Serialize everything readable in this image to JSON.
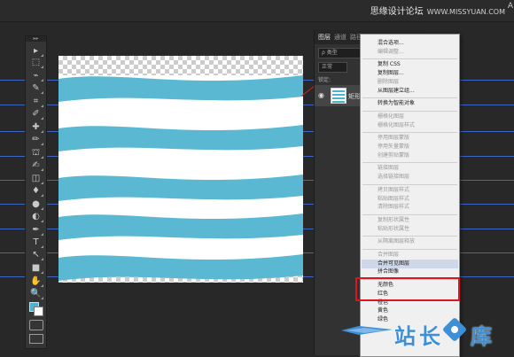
{
  "header": {
    "watermark": "思缘设计论坛",
    "watermark_url": "WWW.MISSYUAN.COM",
    "right_glyph": "A"
  },
  "tools": {
    "panel_grip": "▸▸",
    "icons": [
      "move-icon",
      "marquee-icon",
      "lasso-icon",
      "quick-select-icon",
      "crop-icon",
      "eyedropper-icon",
      "healing-brush-icon",
      "brush-icon",
      "clone-stamp-icon",
      "history-brush-icon",
      "eraser-icon",
      "paint-bucket-icon",
      "blur-icon",
      "dodge-icon",
      "pen-icon",
      "type-icon",
      "path-select-icon",
      "rectangle-icon",
      "hand-icon",
      "zoom-icon"
    ],
    "glyphs": [
      "▸",
      "⬚",
      "⌁",
      "✎",
      "⌗",
      "✐",
      "✚",
      "✏",
      "⛫",
      "✍",
      "◫",
      "♦",
      "●",
      "◐",
      "✒",
      "T",
      "↖",
      "■",
      "✋",
      "🔍"
    ]
  },
  "colors": {
    "foreground": "#4db3cf",
    "background": "#ffffff",
    "wave": "#5bb8d2"
  },
  "layers_panel": {
    "tabs": [
      "图层",
      "通道",
      "路径"
    ],
    "filter": "ρ 类型",
    "blend_mode": "正常",
    "lock_label": "锁定:",
    "layer_name": "矩形"
  },
  "context_menu": {
    "items": [
      {
        "label": "混合选项...",
        "enabled": true
      },
      {
        "label": "编辑调整...",
        "enabled": false
      },
      {
        "sep": true
      },
      {
        "label": "复制 CSS",
        "enabled": true
      },
      {
        "label": "复制图层...",
        "enabled": true
      },
      {
        "label": "删除图层",
        "enabled": false
      },
      {
        "label": "从图层建立组...",
        "enabled": true
      },
      {
        "sep": true
      },
      {
        "label": "转换为智能对象",
        "enabled": true
      },
      {
        "sep": true
      },
      {
        "label": "栅格化图层",
        "enabled": false
      },
      {
        "label": "栅格化图层样式",
        "enabled": false
      },
      {
        "sep": true
      },
      {
        "label": "停用图层蒙版",
        "enabled": false
      },
      {
        "label": "停用矢量蒙版",
        "enabled": false
      },
      {
        "label": "创建剪贴蒙版",
        "enabled": false
      },
      {
        "sep": true
      },
      {
        "label": "链接图层",
        "enabled": false
      },
      {
        "label": "选择链接图层",
        "enabled": false
      },
      {
        "sep": true
      },
      {
        "label": "拷贝图层样式",
        "enabled": false
      },
      {
        "label": "粘贴图层样式",
        "enabled": false
      },
      {
        "label": "清除图层样式",
        "enabled": false
      },
      {
        "sep": true
      },
      {
        "label": "复制形状属性",
        "enabled": false
      },
      {
        "label": "粘贴形状属性",
        "enabled": false
      },
      {
        "sep": true
      },
      {
        "label": "从隔离图层释放",
        "enabled": false
      },
      {
        "sep": true
      },
      {
        "label": "合并图层",
        "enabled": false
      },
      {
        "label": "合并可见图层",
        "enabled": true,
        "highlighted": true
      },
      {
        "label": "拼合图像",
        "enabled": true
      },
      {
        "sep": true
      },
      {
        "label": "无颜色",
        "enabled": true
      },
      {
        "label": "红色",
        "enabled": true
      },
      {
        "label": "橙色",
        "enabled": true
      },
      {
        "label": "黄色",
        "enabled": true
      },
      {
        "label": "绿色",
        "enabled": true
      }
    ]
  },
  "watermark_bottom": {
    "text": "站长",
    "text2": "库"
  }
}
